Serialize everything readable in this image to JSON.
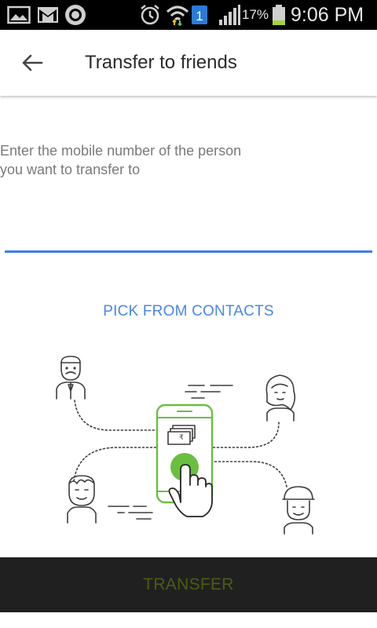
{
  "status_bar": {
    "battery_pct": "17%",
    "time": "9:06 PM",
    "sim_badge": "1",
    "icons": [
      "gallery-icon",
      "gmail-icon",
      "sync-icon",
      "alarm-icon",
      "wifi-icon",
      "sim-icon",
      "signal-icon",
      "battery-icon"
    ]
  },
  "header": {
    "title": "Transfer to friends",
    "back_icon": "arrow-left-icon"
  },
  "form": {
    "prompt": "Enter the mobile number of the person you want to transfer to",
    "phone_value": "",
    "pick_contacts_label": "PICK FROM CONTACTS"
  },
  "illustration": {
    "currency_symbol": "₹",
    "accent_color": "#6abf3f"
  },
  "footer": {
    "transfer_label": "TRANSFER"
  },
  "colors": {
    "accent_blue": "#4a86e8",
    "underline_blue": "#3e7ee6",
    "button_bg": "#202020",
    "button_text_disabled": "#4c5c16",
    "phone_green": "#6abf3f"
  }
}
